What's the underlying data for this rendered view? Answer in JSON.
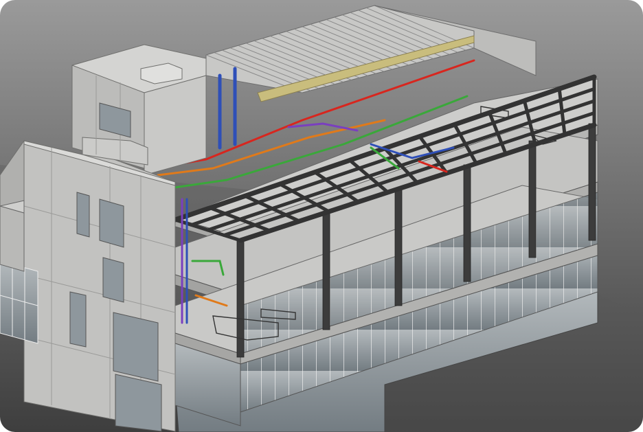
{
  "scene": {
    "background_top": "#9a9a9a",
    "background_bottom": "#3e3e3e",
    "concrete_light": "#d6d6d4",
    "concrete_mid": "#b9b9b7",
    "concrete_dark": "#9d9d9b",
    "slab_top": "#cfcfcd",
    "steel": "#3a3a3a",
    "glass": "#8d969c",
    "roof": "#bcbcbc"
  },
  "mep": {
    "fire_line": "#d8261e",
    "water_line": "#2e4fb8",
    "drain_line": "#3aa83a",
    "gas_line": "#e07a1a",
    "electrical_line": "#7a3fbf",
    "duct": "#c9bd7d"
  }
}
